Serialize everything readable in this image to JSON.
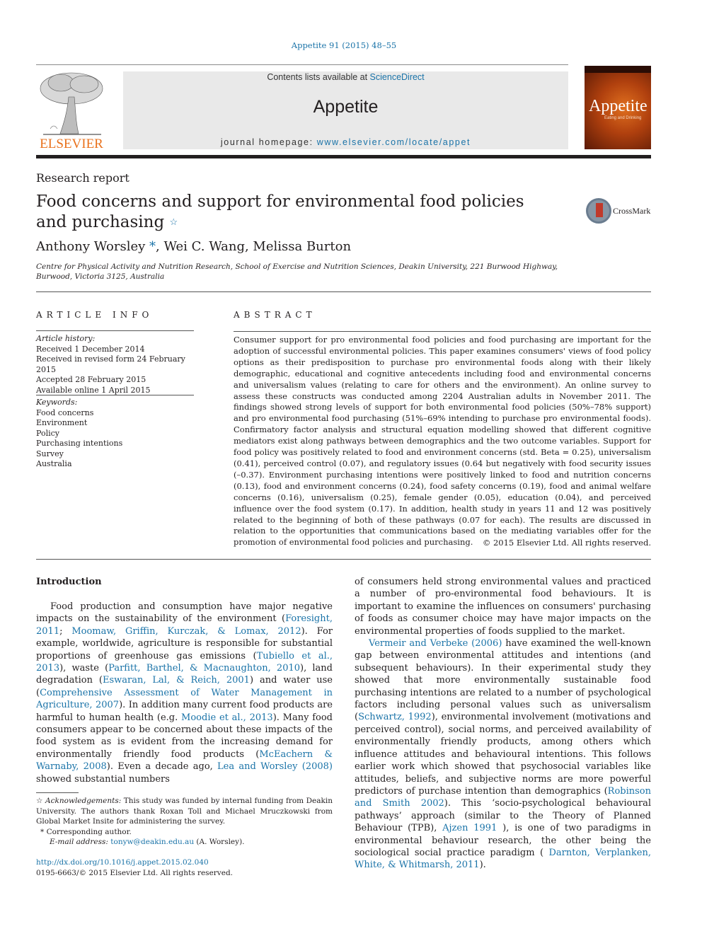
{
  "header": {
    "citation": "Appetite 91 (2015) 48–55",
    "contents_prefix": "Contents lists available at ",
    "contents_link": "ScienceDirect",
    "journal_name": "Appetite",
    "homepage_prefix": "journal homepage: ",
    "homepage_link": "www.elsevier.com/locate/appet",
    "publisher_logo_text": "ELSEVIER",
    "cover_title": "Appetite",
    "cover_subtitle": "Eating and Drinking",
    "crossmark_label": "CrossMark"
  },
  "article": {
    "type": "Research report",
    "title": "Food concerns and support for environmental food policies and purchasing",
    "title_mark": "☆",
    "authors": [
      {
        "name": "Anthony Worsley",
        "mark": "*"
      },
      {
        "name": ", Wei C. Wang, Melissa Burton",
        "mark": ""
      }
    ],
    "affiliation": "Centre for Physical Activity and Nutrition Research, School of Exercise and Nutrition Sciences, Deakin University, 221 Burwood Highway, Burwood, Victoria 3125, Australia"
  },
  "article_info": {
    "heading": "ARTICLE INFO",
    "history_label": "Article history:",
    "history": [
      "Received 1 December 2014",
      "Received in revised form 24 February 2015",
      "Accepted 28 February 2015",
      "Available online 1 April 2015"
    ],
    "keywords_label": "Keywords:",
    "keywords": [
      "Food concerns",
      "Environment",
      "Policy",
      "Purchasing intentions",
      "Survey",
      "Australia"
    ]
  },
  "abstract": {
    "heading": "ABSTRACT",
    "text": "Consumer support for pro environmental food policies and food purchasing are important for the adoption of successful environmental policies. This paper examines consumers' views of food policy options as their predisposition to purchase pro environmental foods along with their likely demographic, educational and cognitive antecedents including food and environmental concerns and universalism values (relating to care for others and the environment). An online survey to assess these constructs was conducted among 2204 Australian adults in November 2011. The findings showed strong levels of support for both environmental food policies (50%–78% support) and pro environmental food purchasing (51%–69% intending to purchase pro environmental foods). Confirmatory factor analysis and structural equation modelling showed that different cognitive mediators exist along pathways between demographics and the two outcome variables. Support for food policy was positively related to food and environment concerns (std. Beta = 0.25), universalism (0.41), perceived control (0.07), and regulatory issues (0.64 but negatively with food security issues (–0.37). Environment purchasing intentions were positively linked to food and nutrition concerns (0.13), food and environment concerns (0.24), food safety concerns (0.19), food and animal welfare concerns (0.16), universalism (0.25), female gender (0.05), education (0.04), and perceived influence over the food system (0.17). In addition, health study in years 11 and 12 was positively related to the beginning of both of these pathways (0.07 for each). The results are discussed in relation to the opportunities that communications based on the mediating variables offer for the promotion of environmental food policies and purchasing.",
    "copyright": "© 2015 Elsevier Ltd. All rights reserved."
  },
  "body": {
    "intro_heading": "Introduction",
    "left_column": [
      {
        "t": "Food production and consumption have major negative impacts on the sustainability of the environment ("
      },
      {
        "l": "Foresight, 2011"
      },
      {
        "t": "; "
      },
      {
        "l": "Moomaw, Griffin, Kurczak, & Lomax, 2012"
      },
      {
        "t": "). For example, worldwide, agriculture is responsible for substantial proportions of greenhouse gas emissions ("
      },
      {
        "l": "Tubiello et al., 2013"
      },
      {
        "t": "), waste ("
      },
      {
        "l": "Parfitt, Barthel, & Macnaughton, 2010"
      },
      {
        "t": "), land degradation ("
      },
      {
        "l": "Eswaran, Lal, & Reich, 2001"
      },
      {
        "t": ") and water use ("
      },
      {
        "l": "Comprehensive Assessment of Water Management in Agriculture, 2007"
      },
      {
        "t": "). In addition many current food products are harmful to human health (e.g. "
      },
      {
        "l": "Moodie et al., 2013"
      },
      {
        "t": "). Many food consumers appear to be concerned about these impacts of the food system as is evident from the increasing demand for environmentally friendly food products ("
      },
      {
        "l": "McEachern & Warnaby, 2008"
      },
      {
        "t": "). Even a decade ago, "
      },
      {
        "l": "Lea and Worsley (2008)"
      },
      {
        "t": " showed substantial numbers"
      }
    ],
    "right_column_p1": [
      {
        "t": "of consumers held strong environmental values and practiced a number of pro-environmental food behaviours. It is important to examine the influences on consumers' purchasing of foods as consumer choice may have major impacts on the environmental properties of foods supplied to the market."
      }
    ],
    "right_column_p2": [
      {
        "l": "Vermeir and Verbeke (2006)"
      },
      {
        "t": " have examined the well-known gap between environmental attitudes and intentions (and subsequent behaviours). In their experimental study they showed that more environmentally sustainable food purchasing intentions are related to a number of psychological factors including personal values such as universalism ("
      },
      {
        "l": "Schwartz, 1992"
      },
      {
        "t": "), environmental involvement (motivations and perceived control), social norms, and perceived availability of environmentally friendly products, among others which influence attitudes and behavioural intentions. This follows earlier work which showed that psychosocial variables like attitudes, beliefs, and subjective norms are more powerful predictors of purchase intention than demographics ("
      },
      {
        "l": "Robinson and Smith 2002"
      },
      {
        "t": "). This ‘socio-psychological behavioural pathways’ approach (similar to the Theory of Planned Behaviour (TPB), "
      },
      {
        "l": "Ajzen 1991"
      },
      {
        "t": " ), is one of two paradigms in environmental behaviour research, the other being the sociological social practice paradigm ( "
      },
      {
        "l": "Darnton, Verplanken, White, & Whitmarsh, 2011"
      },
      {
        "t": ")."
      }
    ]
  },
  "footnotes": {
    "ack_mark": "☆",
    "ack_label": "Acknowledgements:",
    "ack_text": " This study was funded by internal funding from Deakin University. The authors thank Roxan Toll and Michael Mruczkowski from Global Market Insite for administering the survey.",
    "corr_mark": "*",
    "corr_text": " Corresponding author.",
    "email_label": "E-mail address:",
    "email": "tonyw@deakin.edu.au",
    "email_suffix": " (A. Worsley).",
    "doi": "http://dx.doi.org/10.1016/j.appet.2015.02.040",
    "issn_line": "0195-6663/© 2015 Elsevier Ltd. All rights reserved."
  },
  "colors": {
    "link": "#1a73a8",
    "elsevier_orange": "#e9711c",
    "masthead_gray": "#e9e9e9"
  }
}
